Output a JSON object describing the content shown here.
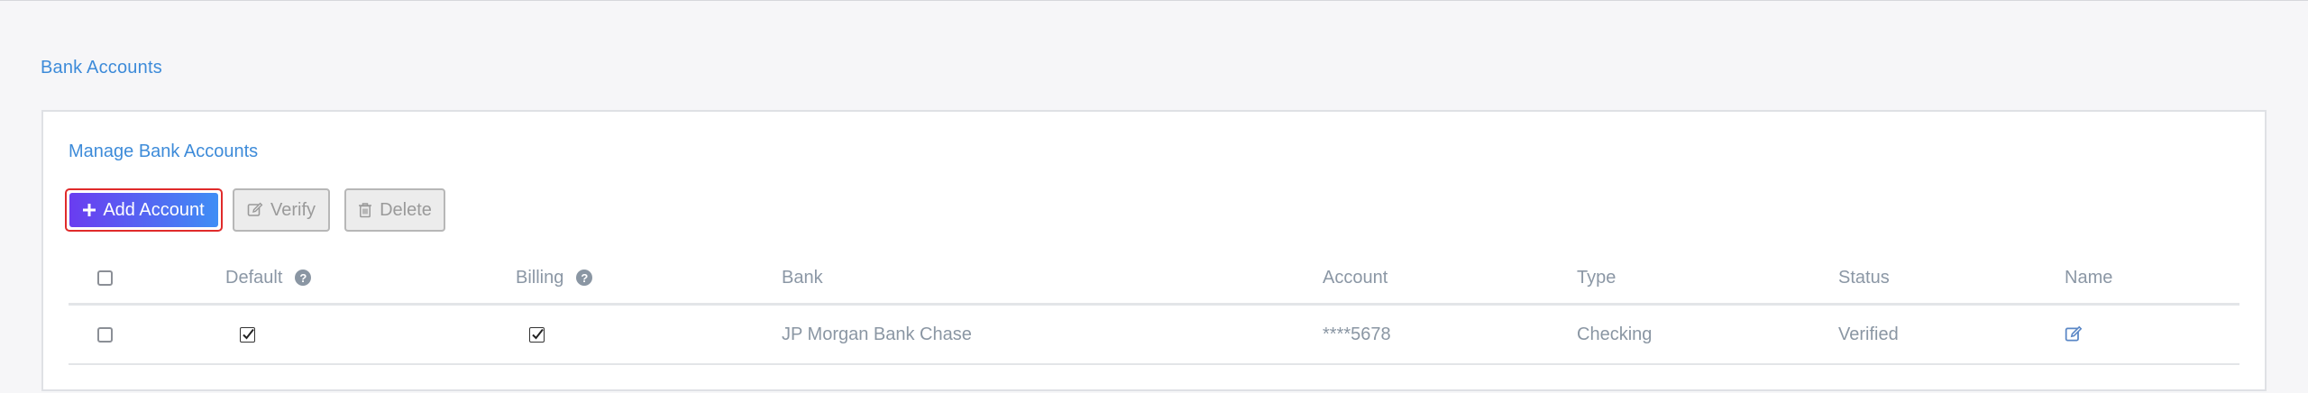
{
  "page": {
    "title": "Bank Accounts"
  },
  "panel": {
    "title": "Manage Bank Accounts"
  },
  "toolbar": {
    "add_label": "Add Account",
    "verify_label": "Verify",
    "delete_label": "Delete"
  },
  "table": {
    "headers": {
      "default": "Default",
      "billing": "Billing",
      "bank": "Bank",
      "account": "Account",
      "type": "Type",
      "status": "Status",
      "name": "Name"
    },
    "rows": [
      {
        "default_checked": true,
        "billing_checked": true,
        "bank": "JP Morgan Bank Chase",
        "account": "****5678",
        "type": "Checking",
        "status": "Verified"
      }
    ]
  },
  "colors": {
    "accent": "#3d8bd9",
    "add_gradient_start": "#6a3cf0",
    "add_gradient_end": "#3f8ef5",
    "highlight_border": "#e02b2b"
  }
}
